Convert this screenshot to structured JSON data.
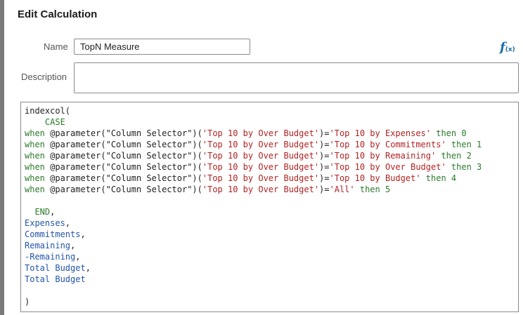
{
  "dialog": {
    "title": "Edit Calculation"
  },
  "form": {
    "name_label": "Name",
    "name_value": "TopN Measure",
    "description_label": "Description",
    "description_value": ""
  },
  "icons": {
    "formula": "function-icon"
  },
  "colors": {
    "keyword": "#2a7a2a",
    "string": "#b22222",
    "field": "#2255aa",
    "text": "#222222",
    "accent": "#1a6ea8"
  },
  "code": {
    "lines": [
      [
        {
          "t": "indexcol(",
          "c": "plain"
        }
      ],
      [
        {
          "t": "    ",
          "c": "plain"
        },
        {
          "t": "CASE",
          "c": "kw"
        }
      ],
      [
        {
          "t": "when ",
          "c": "kw"
        },
        {
          "t": "@parameter(\"Column Selector\")(",
          "c": "plain"
        },
        {
          "t": "'Top 10 by Over Budget'",
          "c": "str"
        },
        {
          "t": ")=",
          "c": "plain"
        },
        {
          "t": "'Top 10 by Expenses'",
          "c": "str"
        },
        {
          "t": " then ",
          "c": "kw"
        },
        {
          "t": "0",
          "c": "num"
        }
      ],
      [
        {
          "t": "when ",
          "c": "kw"
        },
        {
          "t": "@parameter(\"Column Selector\")(",
          "c": "plain"
        },
        {
          "t": "'Top 10 by Over Budget'",
          "c": "str"
        },
        {
          "t": ")=",
          "c": "plain"
        },
        {
          "t": "'Top 10 by Commitments'",
          "c": "str"
        },
        {
          "t": " then ",
          "c": "kw"
        },
        {
          "t": "1",
          "c": "num"
        }
      ],
      [
        {
          "t": "when ",
          "c": "kw"
        },
        {
          "t": "@parameter(\"Column Selector\")(",
          "c": "plain"
        },
        {
          "t": "'Top 10 by Over Budget'",
          "c": "str"
        },
        {
          "t": ")=",
          "c": "plain"
        },
        {
          "t": "'Top 10 by Remaining'",
          "c": "str"
        },
        {
          "t": " then ",
          "c": "kw"
        },
        {
          "t": "2",
          "c": "num"
        }
      ],
      [
        {
          "t": "when ",
          "c": "kw"
        },
        {
          "t": "@parameter(\"Column Selector\")(",
          "c": "plain"
        },
        {
          "t": "'Top 10 by Over Budget'",
          "c": "str"
        },
        {
          "t": ")=",
          "c": "plain"
        },
        {
          "t": "'Top 10 by Over Budget'",
          "c": "str"
        },
        {
          "t": " then ",
          "c": "kw"
        },
        {
          "t": "3",
          "c": "num"
        }
      ],
      [
        {
          "t": "when ",
          "c": "kw"
        },
        {
          "t": "@parameter(\"Column Selector\")(",
          "c": "plain"
        },
        {
          "t": "'Top 10 by Over Budget'",
          "c": "str"
        },
        {
          "t": ")=",
          "c": "plain"
        },
        {
          "t": "'Top 10 by Budget'",
          "c": "str"
        },
        {
          "t": " then ",
          "c": "kw"
        },
        {
          "t": "4",
          "c": "num"
        }
      ],
      [
        {
          "t": "when ",
          "c": "kw"
        },
        {
          "t": "@parameter(\"Column Selector\")(",
          "c": "plain"
        },
        {
          "t": "'Top 10 by Over Budget'",
          "c": "str"
        },
        {
          "t": ")=",
          "c": "plain"
        },
        {
          "t": "'All'",
          "c": "str"
        },
        {
          "t": " then ",
          "c": "kw"
        },
        {
          "t": "5",
          "c": "num"
        }
      ],
      [],
      [
        {
          "t": "  END",
          "c": "kw"
        },
        {
          "t": ",",
          "c": "plain"
        }
      ],
      [
        {
          "t": "Expenses",
          "c": "field"
        },
        {
          "t": ",",
          "c": "plain"
        }
      ],
      [
        {
          "t": "Commitments",
          "c": "field"
        },
        {
          "t": ",",
          "c": "plain"
        }
      ],
      [
        {
          "t": "Remaining",
          "c": "field"
        },
        {
          "t": ",",
          "c": "plain"
        }
      ],
      [
        {
          "t": "-Remaining",
          "c": "field"
        },
        {
          "t": ",",
          "c": "plain"
        }
      ],
      [
        {
          "t": "Total Budget",
          "c": "field"
        },
        {
          "t": ",",
          "c": "plain"
        }
      ],
      [
        {
          "t": "Total Budget",
          "c": "field"
        }
      ],
      [],
      [
        {
          "t": ")",
          "c": "plain"
        }
      ]
    ]
  }
}
